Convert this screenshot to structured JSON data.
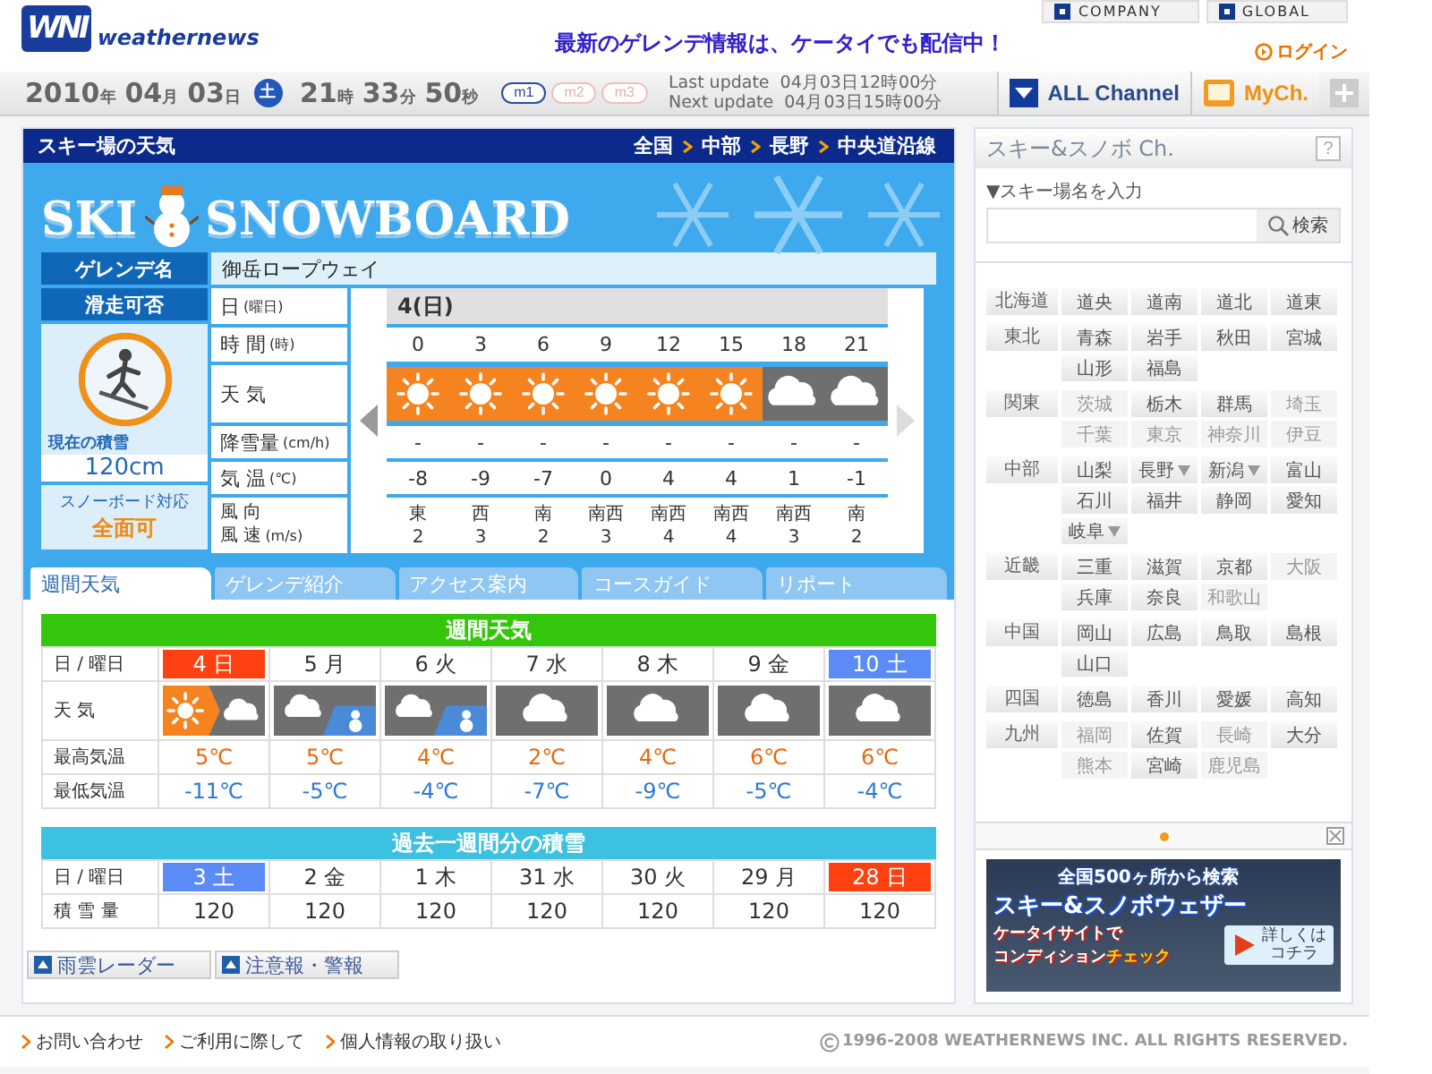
{
  "header": {
    "logo_mark": "WNI",
    "logo_text": "weathernews",
    "headline": "最新のゲレンデ情報は、ケータイでも配信中！",
    "top_links": [
      "COMPANY",
      "GLOBAL"
    ],
    "login": "ログイン"
  },
  "datebar": {
    "date": [
      {
        "num": "2010",
        "unit": "年"
      },
      {
        "num": "04",
        "unit": "月"
      },
      {
        "num": "03",
        "unit": "日"
      }
    ],
    "weekday": "土",
    "time": [
      {
        "num": "21",
        "unit": "時"
      },
      {
        "num": "33",
        "unit": "分"
      },
      {
        "num": "50",
        "unit": "秒"
      }
    ],
    "modes": [
      {
        "label": "m1",
        "selected": true
      },
      {
        "label": "m2",
        "selected": false
      },
      {
        "label": "m3",
        "selected": false
      }
    ],
    "last_update_label": "Last update",
    "last_update": "04月03日12時00分",
    "next_update_label": "Next update",
    "next_update": "04月03日15時00分"
  },
  "channels": [
    {
      "label": "ALL Channel",
      "kind": "all"
    },
    {
      "label": "MyCh.",
      "kind": "my"
    }
  ],
  "main": {
    "title": "スキー場の天気",
    "breadcrumb": [
      "全国",
      "中部",
      "長野",
      "中央道沿線"
    ],
    "banner": {
      "left": "SKI",
      "right": "SNOWBOARD"
    },
    "resort_label": "ゲレンデ名",
    "resort_name": "御岳ロープウェイ",
    "status_label": "滑走可否",
    "snow_label": "現在の積雪",
    "snow_depth": "120cm",
    "board_label": "スノーボード対応",
    "board_value": "全面可",
    "hourly": {
      "row_labels": [
        {
          "text": "日",
          "unit": "(曜日)"
        },
        {
          "text": "時 間",
          "unit": "(時)"
        },
        {
          "text": "天 気"
        },
        {
          "text": "降雪量",
          "unit": "(cm/h)"
        },
        {
          "text": "気 温",
          "unit": "(℃)"
        }
      ],
      "wind_label": {
        "line1": "風 向",
        "line2": "風 速",
        "unit": "(m/s)"
      },
      "day": "4(日)",
      "columns": [
        {
          "hour": "0",
          "kind": "sunny",
          "snowfall": "-",
          "temp": "-8",
          "wind_dir": "東",
          "wind_speed": "2"
        },
        {
          "hour": "3",
          "kind": "sunny",
          "snowfall": "-",
          "temp": "-9",
          "wind_dir": "西",
          "wind_speed": "3"
        },
        {
          "hour": "6",
          "kind": "sunny",
          "snowfall": "-",
          "temp": "-7",
          "wind_dir": "南",
          "wind_speed": "2"
        },
        {
          "hour": "9",
          "kind": "sunny",
          "snowfall": "-",
          "temp": "0",
          "wind_dir": "南西",
          "wind_speed": "3"
        },
        {
          "hour": "12",
          "kind": "sunny",
          "snowfall": "-",
          "temp": "4",
          "wind_dir": "南西",
          "wind_speed": "4"
        },
        {
          "hour": "15",
          "kind": "sunny",
          "snowfall": "-",
          "temp": "4",
          "wind_dir": "南西",
          "wind_speed": "4"
        },
        {
          "hour": "18",
          "kind": "cloudy",
          "snowfall": "-",
          "temp": "1",
          "wind_dir": "南西",
          "wind_speed": "3"
        },
        {
          "hour": "21",
          "kind": "cloudy",
          "snowfall": "-",
          "temp": "-1",
          "wind_dir": "南",
          "wind_speed": "2"
        }
      ]
    },
    "tabs": [
      {
        "label": "週間天気",
        "selected": true
      },
      {
        "label": "ゲレンデ紹介",
        "selected": false
      },
      {
        "label": "アクセス案内",
        "selected": false
      },
      {
        "label": "コースガイド",
        "selected": false
      },
      {
        "label": "リポート",
        "selected": false
      }
    ],
    "weekly": {
      "title": "週間天気",
      "labels": [
        "日 / 曜日",
        "天 気",
        "最高気温",
        "最低気温"
      ],
      "days": [
        {
          "label": "4 日",
          "sunday": true,
          "saturday": false,
          "kind": "sunny_cloudy",
          "high": "5℃",
          "low": "-11℃"
        },
        {
          "label": "5 月",
          "sunday": false,
          "saturday": false,
          "kind": "cloudy_snow",
          "high": "5℃",
          "low": "-5℃"
        },
        {
          "label": "6 火",
          "sunday": false,
          "saturday": false,
          "kind": "cloudy_snow",
          "high": "4℃",
          "low": "-4℃"
        },
        {
          "label": "7 水",
          "sunday": false,
          "saturday": false,
          "kind": "cloudy",
          "high": "2℃",
          "low": "-7℃"
        },
        {
          "label": "8 木",
          "sunday": false,
          "saturday": false,
          "kind": "cloudy",
          "high": "4℃",
          "low": "-9℃"
        },
        {
          "label": "9 金",
          "sunday": false,
          "saturday": false,
          "kind": "cloudy",
          "high": "6℃",
          "low": "-5℃"
        },
        {
          "label": "10 土",
          "sunday": false,
          "saturday": true,
          "kind": "cloudy",
          "high": "6℃",
          "low": "-4℃"
        }
      ]
    },
    "snow": {
      "title": "過去一週間分の積雪",
      "labels": [
        "日 / 曜日",
        "積 雪 量"
      ],
      "days": [
        {
          "label": "3 土",
          "sunday": false,
          "saturday": true,
          "amount": "120"
        },
        {
          "label": "2 金",
          "sunday": false,
          "saturday": false,
          "amount": "120"
        },
        {
          "label": "1 木",
          "sunday": false,
          "saturday": false,
          "amount": "120"
        },
        {
          "label": "31 水",
          "sunday": false,
          "saturday": false,
          "amount": "120"
        },
        {
          "label": "30 火",
          "sunday": false,
          "saturday": false,
          "amount": "120"
        },
        {
          "label": "29 月",
          "sunday": false,
          "saturday": false,
          "amount": "120"
        },
        {
          "label": "28 日",
          "sunday": true,
          "saturday": false,
          "amount": "120"
        }
      ]
    },
    "bottom_links": [
      "雨雲レーダー",
      "注意報・警報"
    ]
  },
  "sidebar": {
    "title": "スキー&スノボ Ch.",
    "help": "?",
    "search_label": "▼スキー場名を入力",
    "search_button": "検索",
    "regions": [
      {
        "name": "北海道",
        "prefs": [
          {
            "label": "道央",
            "disabled": false,
            "dropdown": false
          },
          {
            "label": "道南",
            "disabled": false,
            "dropdown": false
          },
          {
            "label": "道北",
            "disabled": false,
            "dropdown": false
          },
          {
            "label": "道東",
            "disabled": false,
            "dropdown": false
          }
        ]
      },
      {
        "name": "東北",
        "prefs": [
          {
            "label": "青森",
            "disabled": false,
            "dropdown": false
          },
          {
            "label": "岩手",
            "disabled": false,
            "dropdown": false
          },
          {
            "label": "秋田",
            "disabled": false,
            "dropdown": false
          },
          {
            "label": "宮城",
            "disabled": false,
            "dropdown": false
          },
          {
            "label": "山形",
            "disabled": false,
            "dropdown": false
          },
          {
            "label": "福島",
            "disabled": false,
            "dropdown": false
          }
        ]
      },
      {
        "name": "関東",
        "prefs": [
          {
            "label": "茨城",
            "disabled": true,
            "dropdown": false
          },
          {
            "label": "栃木",
            "disabled": false,
            "dropdown": false
          },
          {
            "label": "群馬",
            "disabled": false,
            "dropdown": false
          },
          {
            "label": "埼玉",
            "disabled": true,
            "dropdown": false
          },
          {
            "label": "千葉",
            "disabled": true,
            "dropdown": false
          },
          {
            "label": "東京",
            "disabled": true,
            "dropdown": false
          },
          {
            "label": "神奈川",
            "disabled": true,
            "dropdown": false
          },
          {
            "label": "伊豆",
            "disabled": true,
            "dropdown": false
          }
        ]
      },
      {
        "name": "中部",
        "prefs": [
          {
            "label": "山梨",
            "disabled": false,
            "dropdown": false
          },
          {
            "label": "長野",
            "disabled": false,
            "dropdown": true
          },
          {
            "label": "新潟",
            "disabled": false,
            "dropdown": true
          },
          {
            "label": "富山",
            "disabled": false,
            "dropdown": false
          },
          {
            "label": "石川",
            "disabled": false,
            "dropdown": false
          },
          {
            "label": "福井",
            "disabled": false,
            "dropdown": false
          },
          {
            "label": "静岡",
            "disabled": false,
            "dropdown": false
          },
          {
            "label": "愛知",
            "disabled": false,
            "dropdown": false
          },
          {
            "label": "岐阜",
            "disabled": false,
            "dropdown": true
          }
        ]
      },
      {
        "name": "近畿",
        "prefs": [
          {
            "label": "三重",
            "disabled": false,
            "dropdown": false
          },
          {
            "label": "滋賀",
            "disabled": false,
            "dropdown": false
          },
          {
            "label": "京都",
            "disabled": false,
            "dropdown": false
          },
          {
            "label": "大阪",
            "disabled": true,
            "dropdown": false
          },
          {
            "label": "兵庫",
            "disabled": false,
            "dropdown": false
          },
          {
            "label": "奈良",
            "disabled": false,
            "dropdown": false
          },
          {
            "label": "和歌山",
            "disabled": true,
            "dropdown": false
          }
        ]
      },
      {
        "name": "中国",
        "prefs": [
          {
            "label": "岡山",
            "disabled": false,
            "dropdown": false
          },
          {
            "label": "広島",
            "disabled": false,
            "dropdown": false
          },
          {
            "label": "鳥取",
            "disabled": false,
            "dropdown": false
          },
          {
            "label": "島根",
            "disabled": false,
            "dropdown": false
          },
          {
            "label": "山口",
            "disabled": false,
            "dropdown": false
          }
        ]
      },
      {
        "name": "四国",
        "prefs": [
          {
            "label": "徳島",
            "disabled": false,
            "dropdown": false
          },
          {
            "label": "香川",
            "disabled": false,
            "dropdown": false
          },
          {
            "label": "愛媛",
            "disabled": false,
            "dropdown": false
          },
          {
            "label": "高知",
            "disabled": false,
            "dropdown": false
          }
        ]
      },
      {
        "name": "九州",
        "prefs": [
          {
            "label": "福岡",
            "disabled": true,
            "dropdown": false
          },
          {
            "label": "佐賀",
            "disabled": false,
            "dropdown": false
          },
          {
            "label": "長崎",
            "disabled": true,
            "dropdown": false
          },
          {
            "label": "大分",
            "disabled": false,
            "dropdown": false
          },
          {
            "label": "熊本",
            "disabled": true,
            "dropdown": false
          },
          {
            "label": "宮崎",
            "disabled": false,
            "dropdown": false
          },
          {
            "label": "鹿児島",
            "disabled": true,
            "dropdown": false
          }
        ]
      }
    ],
    "ad": {
      "line1": "全国500ヶ所から検索",
      "line2": "スキー&スノボウェザー",
      "line3": "ケータイサイトで",
      "line4a": "コンディション",
      "line4b": "チェック",
      "cta1": "詳しくは",
      "cta2": "コチラ"
    }
  },
  "footer": {
    "links": [
      "お問い合わせ",
      "ご利用に際して",
      "個人情報の取り扱い"
    ],
    "copyright": "1996-2008 WEATHERNEWS INC. ALL RIGHTS RESERVED."
  }
}
